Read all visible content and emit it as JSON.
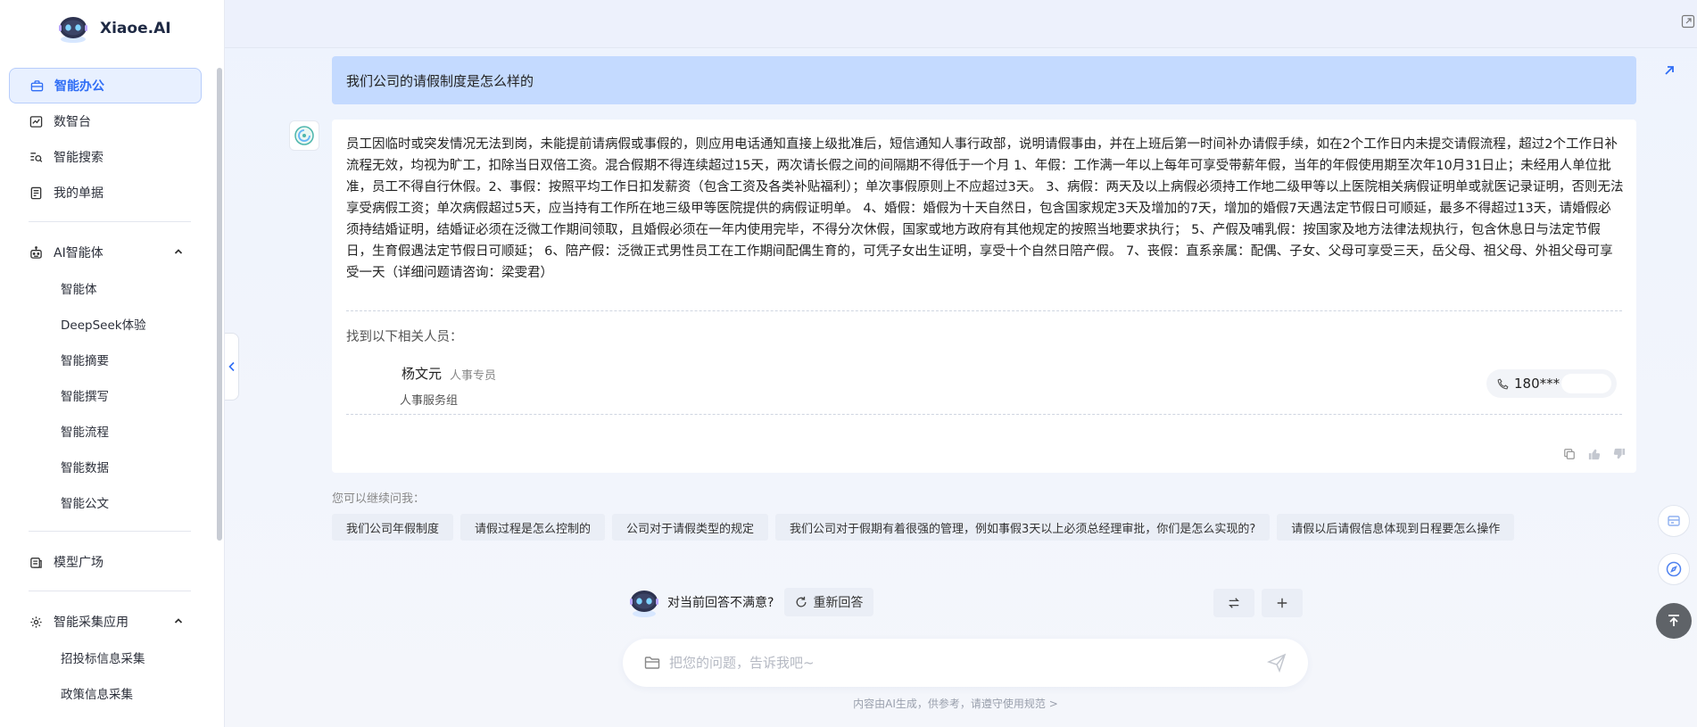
{
  "app": {
    "name": "Xiaoe.AI"
  },
  "sidebar": {
    "items": [
      {
        "label": "智能办公",
        "icon": "briefcase-icon",
        "active": true
      },
      {
        "label": "数智台",
        "icon": "chart-line-icon"
      },
      {
        "label": "智能搜索",
        "icon": "search-list-icon"
      },
      {
        "label": "我的单据",
        "icon": "document-icon"
      }
    ],
    "ai_group": {
      "label": "AI智能体",
      "icon": "robot-icon",
      "children": [
        "智能体",
        "DeepSeek体验",
        "智能摘要",
        "智能撰写",
        "智能流程",
        "智能数据",
        "智能公文"
      ]
    },
    "model_square": {
      "label": "模型广场",
      "icon": "cube-icon"
    },
    "collect_group": {
      "label": "智能采集应用",
      "icon": "gear-icon",
      "children": [
        "招投标信息采集",
        "政策信息采集"
      ]
    }
  },
  "chat": {
    "question": "我们公司的请假制度是怎么样的",
    "answer": "员工因临时或突发情况无法到岗，未能提前请病假或事假的，则应用电话通知直接上级批准后，短信通知人事行政部，说明请假事由，并在上班后第一时间补办请假手续，如在2个工作日内未提交请假流程，超过2个工作日补流程无效，均视为旷工，扣除当日双倍工资。混合假期不得连续超过15天，两次请长假之间的间隔期不得低于一个月 1、年假：工作满一年以上每年可享受带薪年假，当年的年假使用期至次年10月31日止；未经用人单位批准，员工不得自行休假。2、事假：按照平均工作日扣发薪资（包含工资及各类补贴福利）；单次事假原则上不应超过3天。 3、病假：两天及以上病假必须持工作地二级甲等以上医院相关病假证明单或就医记录证明，否则无法享受病假工资；单次病假超过5天，应当持有工作所在地三级甲等医院提供的病假证明单。 4、婚假：婚假为十天自然日，包含国家规定3天及增加的7天，增加的婚假7天遇法定节假日可顺延，最多不得超过13天，请婚假必须持结婚证明，结婚证必须在泛微工作期间领取，且婚假必须在一年内使用完毕，不得分次休假，国家或地方政府有其他规定的按照当地要求执行； 5、产假及哺乳假：按国家及地方法律法规执行，包含休息日与法定节假日，生育假遇法定节假日可顺延； 6、陪产假：泛微正式男性员工在工作期间配偶生育的，可凭子女出生证明，享受十个自然日陪产假。 7、丧假：直系亲属：配偶、子女、父母可享受三天，岳父母、祖父母、外祖父母可享受一天（详细问题请咨询：梁雯君）",
    "found_title": "找到以下相关人员：",
    "person": {
      "name": "杨文元",
      "role": "人事专员",
      "dept": "人事服务组",
      "phone": "180***"
    },
    "suggest_title": "您可以继续问我：",
    "suggestions": [
      "我们公司年假制度",
      "请假过程是怎么控制的",
      "公司对于请假类型的规定",
      "我们公司对于假期有着很强的管理，例如事假3天以上必须总经理审批，你们是怎么实现的?",
      "请假以后请假信息体现到日程要怎么操作"
    ],
    "unsatisfied": "对当前回答不满意?",
    "regenerate": "重新回答",
    "input_placeholder": "把您的问题，告诉我吧~",
    "footnote": "内容由AI生成，供参考，请遵守使用规范",
    "footnote_arrow": ">"
  },
  "colors": {
    "accent": "#2f6df5",
    "question_bg": "#c4daff",
    "active_nav_bg": "#e8f0ff"
  }
}
